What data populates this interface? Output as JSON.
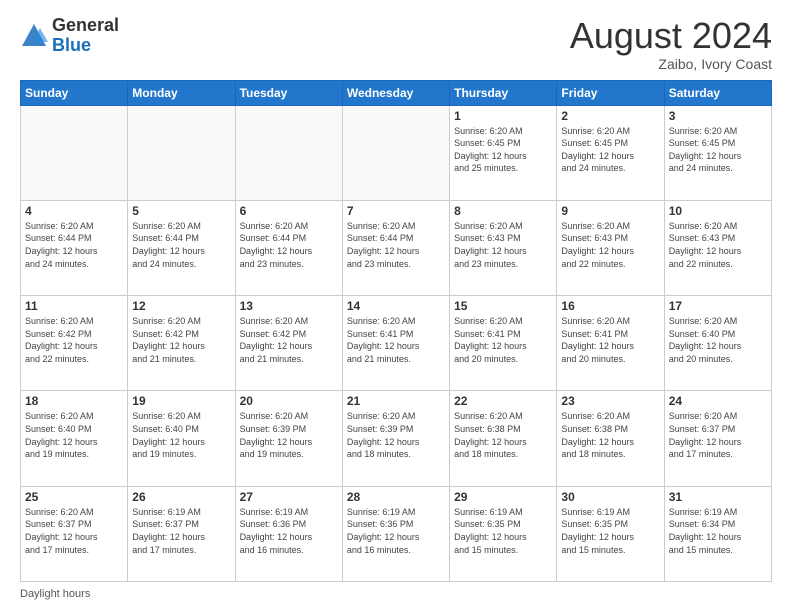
{
  "logo": {
    "general": "General",
    "blue": "Blue"
  },
  "header": {
    "title": "August 2024",
    "subtitle": "Zaibo, Ivory Coast"
  },
  "footer": {
    "daylight_label": "Daylight hours"
  },
  "weekdays": [
    "Sunday",
    "Monday",
    "Tuesday",
    "Wednesday",
    "Thursday",
    "Friday",
    "Saturday"
  ],
  "weeks": [
    [
      {
        "day": "",
        "info": ""
      },
      {
        "day": "",
        "info": ""
      },
      {
        "day": "",
        "info": ""
      },
      {
        "day": "",
        "info": ""
      },
      {
        "day": "1",
        "info": "Sunrise: 6:20 AM\nSunset: 6:45 PM\nDaylight: 12 hours\nand 25 minutes."
      },
      {
        "day": "2",
        "info": "Sunrise: 6:20 AM\nSunset: 6:45 PM\nDaylight: 12 hours\nand 24 minutes."
      },
      {
        "day": "3",
        "info": "Sunrise: 6:20 AM\nSunset: 6:45 PM\nDaylight: 12 hours\nand 24 minutes."
      }
    ],
    [
      {
        "day": "4",
        "info": "Sunrise: 6:20 AM\nSunset: 6:44 PM\nDaylight: 12 hours\nand 24 minutes."
      },
      {
        "day": "5",
        "info": "Sunrise: 6:20 AM\nSunset: 6:44 PM\nDaylight: 12 hours\nand 24 minutes."
      },
      {
        "day": "6",
        "info": "Sunrise: 6:20 AM\nSunset: 6:44 PM\nDaylight: 12 hours\nand 23 minutes."
      },
      {
        "day": "7",
        "info": "Sunrise: 6:20 AM\nSunset: 6:44 PM\nDaylight: 12 hours\nand 23 minutes."
      },
      {
        "day": "8",
        "info": "Sunrise: 6:20 AM\nSunset: 6:43 PM\nDaylight: 12 hours\nand 23 minutes."
      },
      {
        "day": "9",
        "info": "Sunrise: 6:20 AM\nSunset: 6:43 PM\nDaylight: 12 hours\nand 22 minutes."
      },
      {
        "day": "10",
        "info": "Sunrise: 6:20 AM\nSunset: 6:43 PM\nDaylight: 12 hours\nand 22 minutes."
      }
    ],
    [
      {
        "day": "11",
        "info": "Sunrise: 6:20 AM\nSunset: 6:42 PM\nDaylight: 12 hours\nand 22 minutes."
      },
      {
        "day": "12",
        "info": "Sunrise: 6:20 AM\nSunset: 6:42 PM\nDaylight: 12 hours\nand 21 minutes."
      },
      {
        "day": "13",
        "info": "Sunrise: 6:20 AM\nSunset: 6:42 PM\nDaylight: 12 hours\nand 21 minutes."
      },
      {
        "day": "14",
        "info": "Sunrise: 6:20 AM\nSunset: 6:41 PM\nDaylight: 12 hours\nand 21 minutes."
      },
      {
        "day": "15",
        "info": "Sunrise: 6:20 AM\nSunset: 6:41 PM\nDaylight: 12 hours\nand 20 minutes."
      },
      {
        "day": "16",
        "info": "Sunrise: 6:20 AM\nSunset: 6:41 PM\nDaylight: 12 hours\nand 20 minutes."
      },
      {
        "day": "17",
        "info": "Sunrise: 6:20 AM\nSunset: 6:40 PM\nDaylight: 12 hours\nand 20 minutes."
      }
    ],
    [
      {
        "day": "18",
        "info": "Sunrise: 6:20 AM\nSunset: 6:40 PM\nDaylight: 12 hours\nand 19 minutes."
      },
      {
        "day": "19",
        "info": "Sunrise: 6:20 AM\nSunset: 6:40 PM\nDaylight: 12 hours\nand 19 minutes."
      },
      {
        "day": "20",
        "info": "Sunrise: 6:20 AM\nSunset: 6:39 PM\nDaylight: 12 hours\nand 19 minutes."
      },
      {
        "day": "21",
        "info": "Sunrise: 6:20 AM\nSunset: 6:39 PM\nDaylight: 12 hours\nand 18 minutes."
      },
      {
        "day": "22",
        "info": "Sunrise: 6:20 AM\nSunset: 6:38 PM\nDaylight: 12 hours\nand 18 minutes."
      },
      {
        "day": "23",
        "info": "Sunrise: 6:20 AM\nSunset: 6:38 PM\nDaylight: 12 hours\nand 18 minutes."
      },
      {
        "day": "24",
        "info": "Sunrise: 6:20 AM\nSunset: 6:37 PM\nDaylight: 12 hours\nand 17 minutes."
      }
    ],
    [
      {
        "day": "25",
        "info": "Sunrise: 6:20 AM\nSunset: 6:37 PM\nDaylight: 12 hours\nand 17 minutes."
      },
      {
        "day": "26",
        "info": "Sunrise: 6:19 AM\nSunset: 6:37 PM\nDaylight: 12 hours\nand 17 minutes."
      },
      {
        "day": "27",
        "info": "Sunrise: 6:19 AM\nSunset: 6:36 PM\nDaylight: 12 hours\nand 16 minutes."
      },
      {
        "day": "28",
        "info": "Sunrise: 6:19 AM\nSunset: 6:36 PM\nDaylight: 12 hours\nand 16 minutes."
      },
      {
        "day": "29",
        "info": "Sunrise: 6:19 AM\nSunset: 6:35 PM\nDaylight: 12 hours\nand 15 minutes."
      },
      {
        "day": "30",
        "info": "Sunrise: 6:19 AM\nSunset: 6:35 PM\nDaylight: 12 hours\nand 15 minutes."
      },
      {
        "day": "31",
        "info": "Sunrise: 6:19 AM\nSunset: 6:34 PM\nDaylight: 12 hours\nand 15 minutes."
      }
    ]
  ]
}
